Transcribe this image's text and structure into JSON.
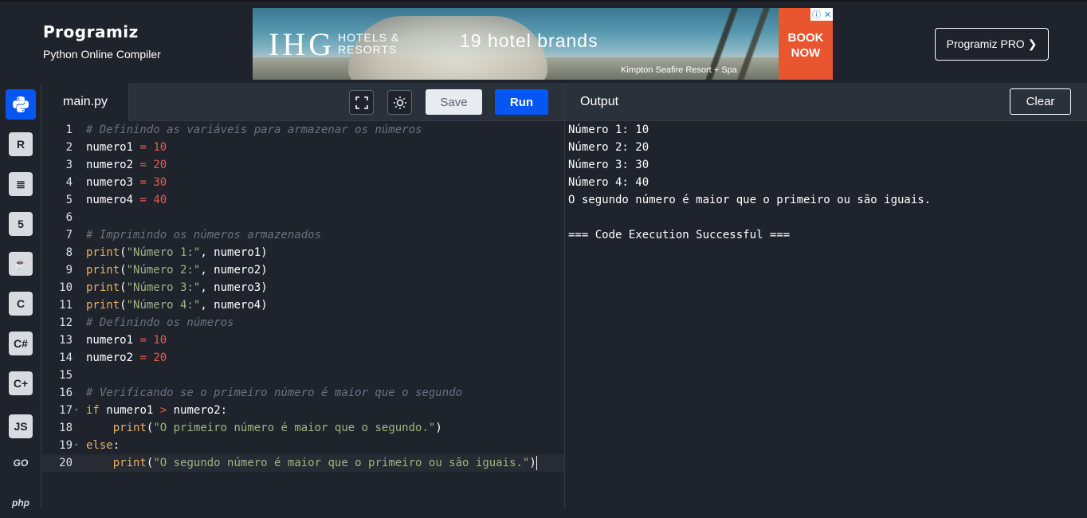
{
  "header": {
    "logo": "Programiz",
    "subtitle": "Python Online Compiler",
    "pro_button": "Programiz PRO ❯"
  },
  "ad": {
    "brand": "IHG",
    "brand_sub_1": "HOTELS &",
    "brand_sub_2": "RESORTS",
    "headline": "19 hotel brands",
    "caption": "Kimpton Seafire Resort + Spa",
    "cta_1": "BOOK",
    "cta_2": "NOW"
  },
  "sidebar": {
    "items": [
      {
        "name": "python",
        "label": "Py"
      },
      {
        "name": "r",
        "label": "R"
      },
      {
        "name": "sql",
        "label": "≣"
      },
      {
        "name": "html",
        "label": "5"
      },
      {
        "name": "java",
        "label": "☕"
      },
      {
        "name": "c",
        "label": "C"
      },
      {
        "name": "csharp",
        "label": "C#"
      },
      {
        "name": "cpp",
        "label": "C+"
      },
      {
        "name": "javascript",
        "label": "JS"
      },
      {
        "name": "go",
        "label": "GO"
      },
      {
        "name": "php",
        "label": "php"
      }
    ]
  },
  "editor": {
    "tab": "main.py",
    "save_label": "Save",
    "run_label": "Run",
    "lines": [
      "1",
      "2",
      "3",
      "4",
      "5",
      "6",
      "7",
      "8",
      "9",
      "10",
      "11",
      "12",
      "13",
      "14",
      "15",
      "16",
      "17",
      "18",
      "19",
      "20"
    ],
    "code": {
      "l1_comment": "# Definindo as variáveis para armazenar os números",
      "l2_var": "numero1",
      "l2_val": "10",
      "l3_var": "numero2",
      "l3_val": "20",
      "l4_var": "numero3",
      "l4_val": "30",
      "l5_var": "numero4",
      "l5_val": "40",
      "l7_comment": "# Imprimindo os números armazenados",
      "l8_str": "\"Número 1:\"",
      "l8_arg": "numero1",
      "l9_str": "\"Número 2:\"",
      "l9_arg": "numero2",
      "l10_str": "\"Número 3:\"",
      "l10_arg": "numero3",
      "l11_str": "\"Número 4:\"",
      "l11_arg": "numero4",
      "l12_comment": "# Definindo os números",
      "l13_var": "numero1",
      "l13_val": "10",
      "l14_var": "numero2",
      "l14_val": "20",
      "l16_comment": "# Verificando se o primeiro número é maior que o segundo",
      "l17_a": "numero1",
      "l17_b": "numero2",
      "l18_str": "\"O primeiro número é maior que o segundo.\"",
      "l20_str": "\"O segundo número é maior que o primeiro ou são iguais.\""
    }
  },
  "output": {
    "title": "Output",
    "clear_label": "Clear",
    "lines": [
      "Número 1: 10",
      "Número 2: 20",
      "Número 3: 30",
      "Número 4: 40",
      "O segundo número é maior que o primeiro ou são iguais.",
      "",
      "=== Code Execution Successful ==="
    ]
  }
}
